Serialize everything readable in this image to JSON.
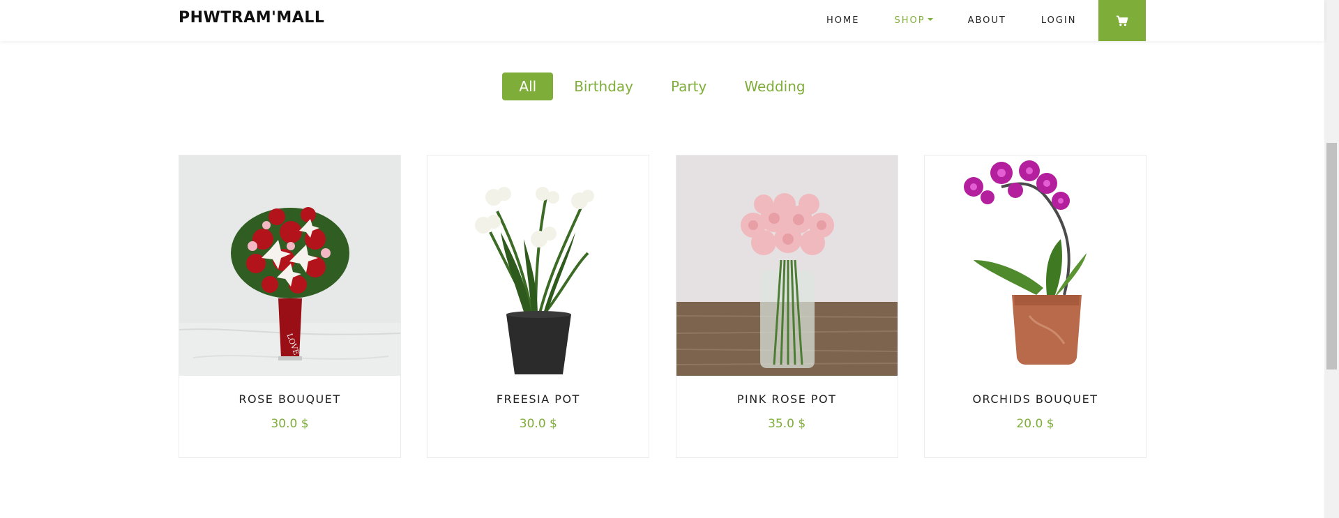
{
  "header": {
    "brand": "PHWTRAM'MALL",
    "nav": [
      {
        "label": "HOME"
      },
      {
        "label": "SHOP"
      },
      {
        "label": "ABOUT"
      },
      {
        "label": "LOGIN"
      }
    ],
    "cart_icon": "shopping-cart-icon"
  },
  "filters": [
    {
      "label": "All",
      "active": true
    },
    {
      "label": "Birthday"
    },
    {
      "label": "Party"
    },
    {
      "label": "Wedding"
    }
  ],
  "products": [
    {
      "name": "ROSE BOUQUET",
      "price": "30.0 $"
    },
    {
      "name": "FREESIA POT",
      "price": "30.0 $"
    },
    {
      "name": "PINK ROSE POT",
      "price": "35.0 $"
    },
    {
      "name": "ORCHIDS BOUQUET",
      "price": "20.0 $"
    }
  ],
  "colors": {
    "accent": "#7fad39",
    "text": "#222222"
  }
}
